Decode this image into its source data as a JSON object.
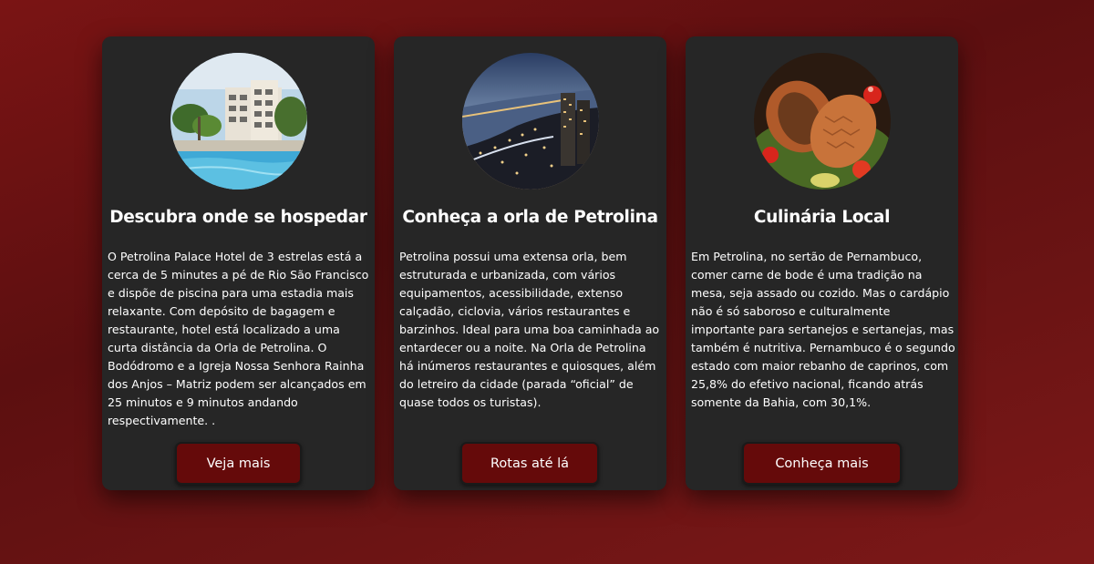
{
  "cards": [
    {
      "image": "hotel-pool-photo",
      "title": "Descubra onde se hospedar",
      "text": "O Petrolina Palace Hotel de 3 estrelas está a cerca de 5 minutes a pé de Rio São Francisco e dispõe de piscina para uma estadia mais relaxante. Com depósito de bagagem e restaurante, hotel está localizado a uma curta distância da Orla de Petrolina. O Bodódromo e a Igreja Nossa Senhora Rainha dos Anjos – Matriz podem ser alcançados em 25 minutos e 9 minutos andando respectivamente. .",
      "button": "Veja mais"
    },
    {
      "image": "petrolina-waterfront-night-photo",
      "title": "Conheça a orla de Petrolina",
      "text": "Petrolina possui uma extensa orla, bem estruturada e urbanizada, com vários equipamentos, acessibilidade, extenso calçadão, ciclovia, vários restaurantes e barzinhos. Ideal para uma boa caminhada ao entardecer ou a noite. Na Orla de Petrolina há inúmeros restaurantes e quiosques, além do letreiro da cidade (parada “oficial” de quase todos os turistas).",
      "button": "Rotas até lá"
    },
    {
      "image": "local-food-photo",
      "title": "Culinária Local",
      "text": "Em Petrolina, no sertão de Pernambuco, comer carne de bode é uma tradição na mesa, seja assado ou cozido. Mas o cardápio não é só saboroso e culturalmente importante para sertanejos e sertanejas, mas também é nutritiva. Pernambuco é o segundo estado com maior rebanho de caprinos, com 25,8% do efetivo nacional, ficando atrás somente da Bahia, com 30,1%.",
      "button": "Conheça mais"
    }
  ],
  "colors": {
    "background": "#6b1414",
    "card": "#262626",
    "button": "#650a0a",
    "text": "#ffffff"
  }
}
